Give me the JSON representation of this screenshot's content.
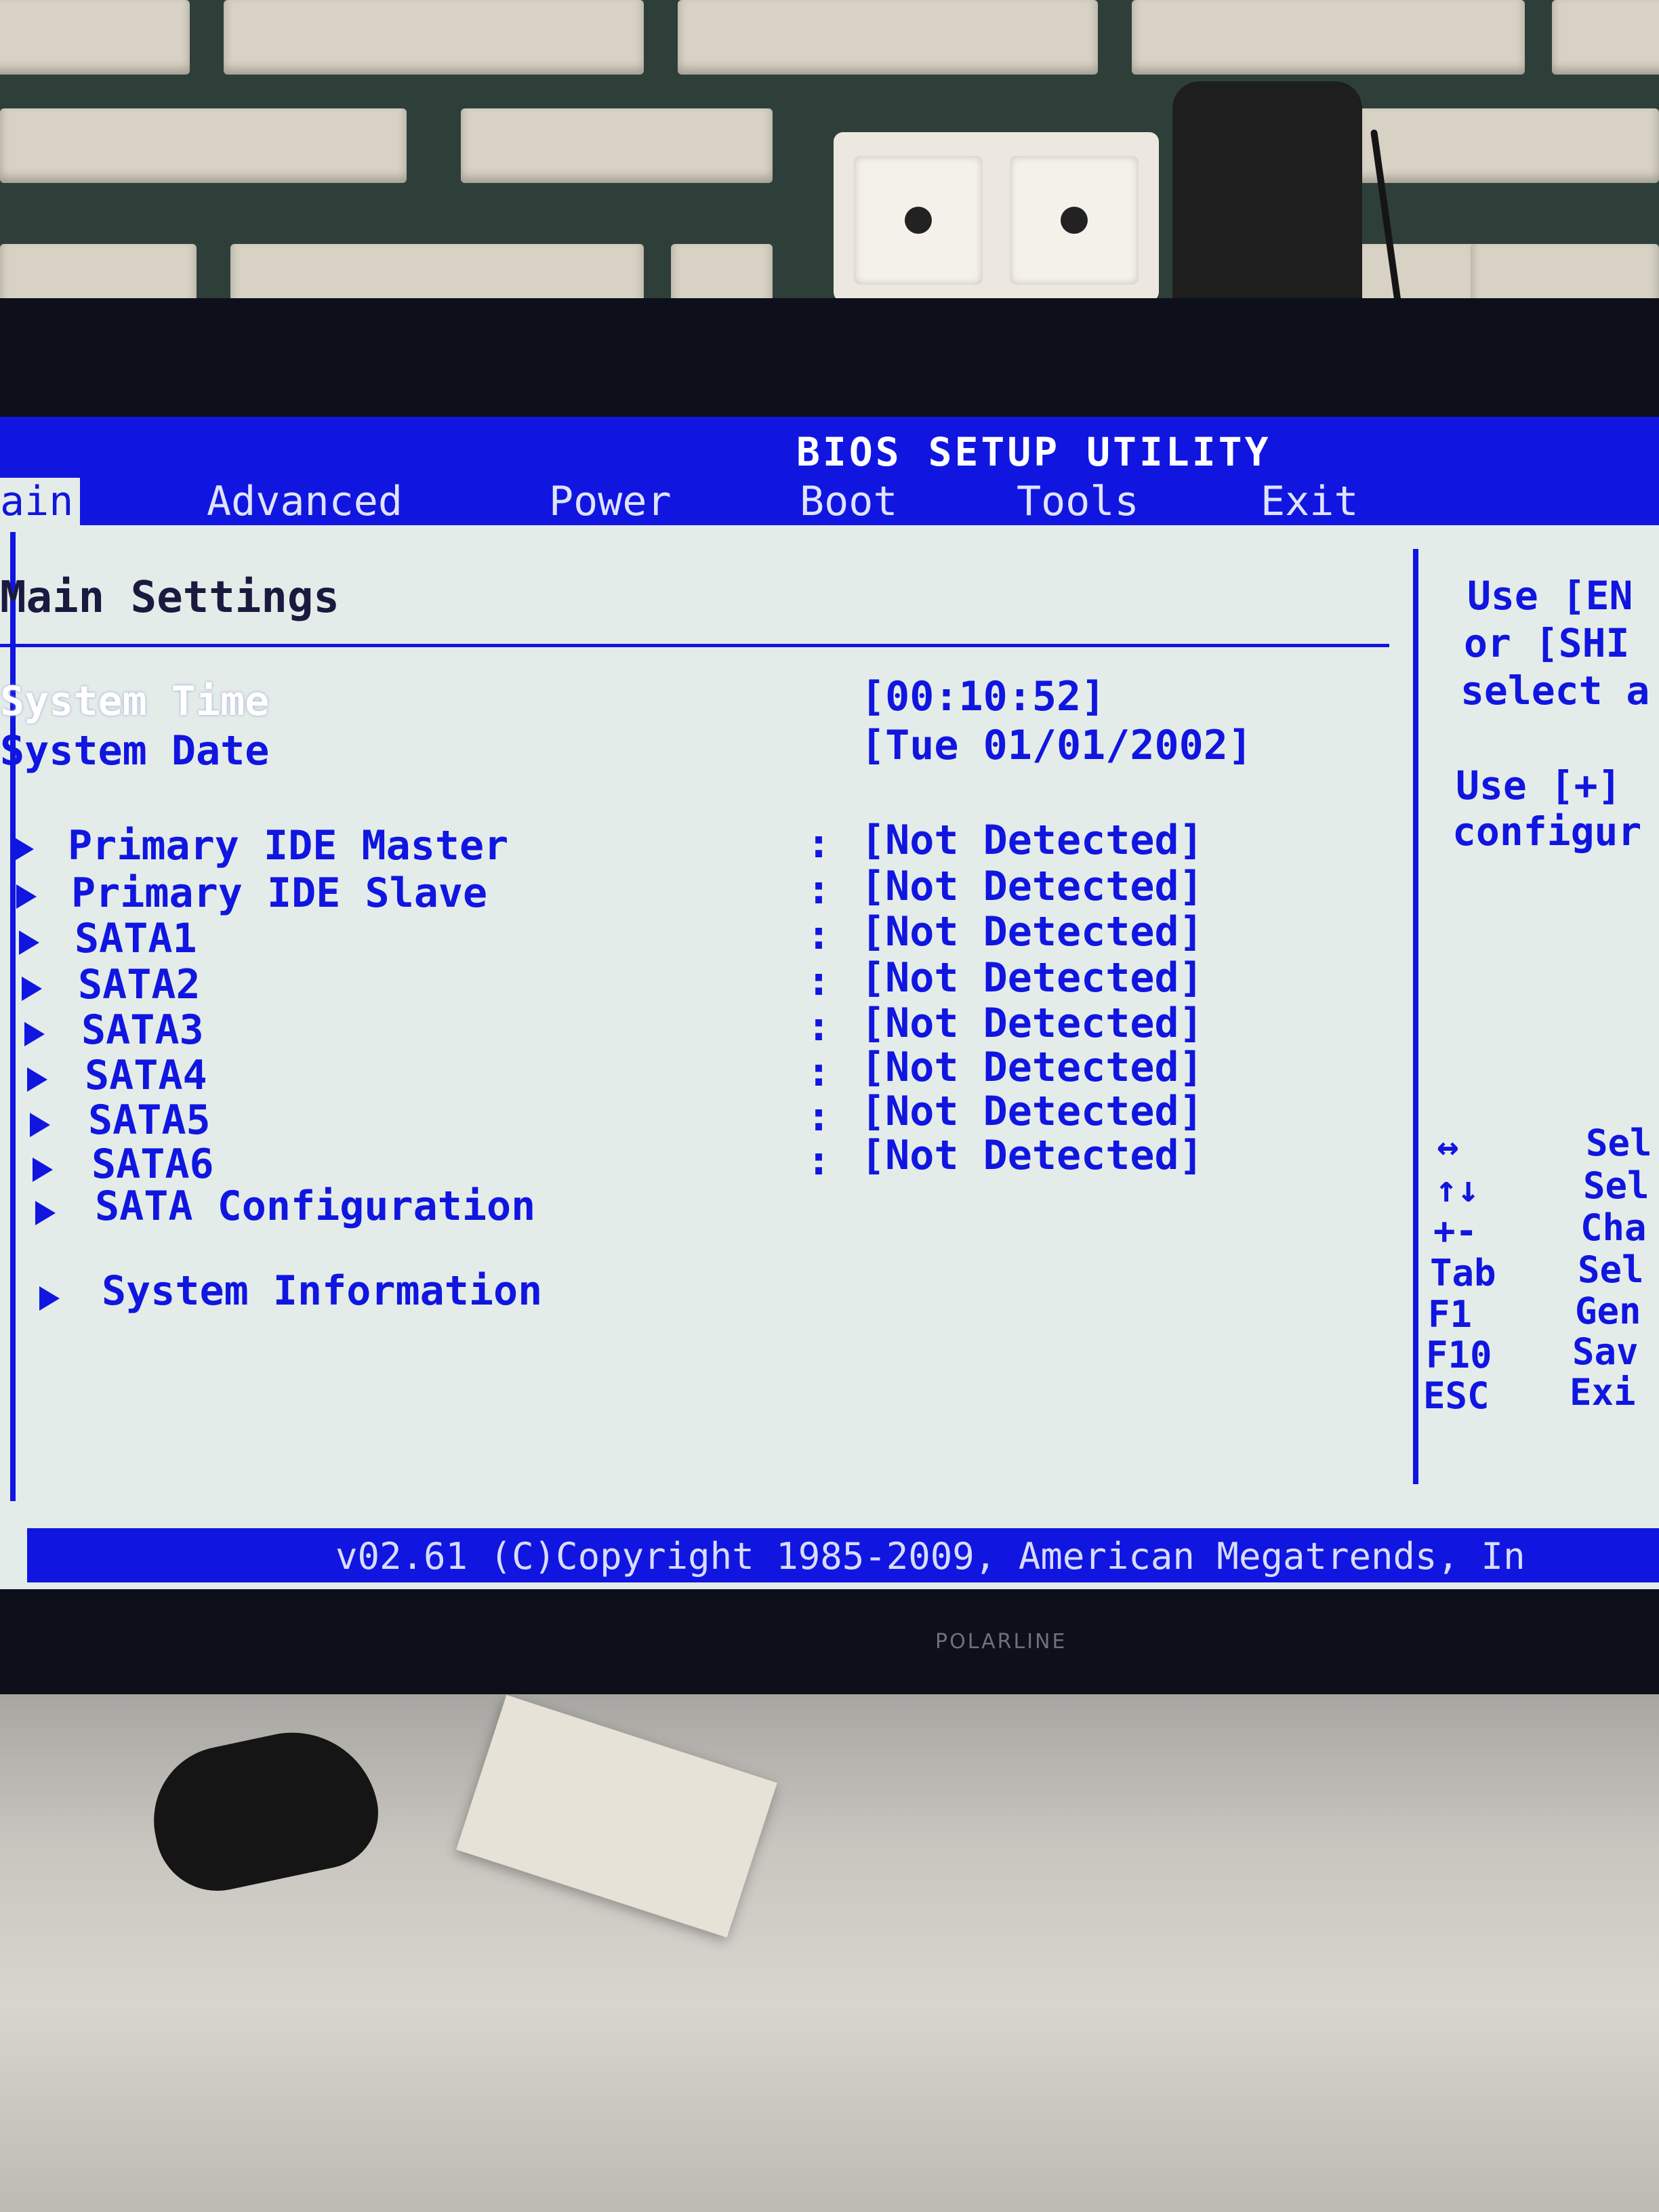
{
  "bios": {
    "title": "BIOS SETUP UTILITY",
    "menu": [
      "ain",
      "Advanced",
      "Power",
      "Boot",
      "Tools",
      "Exit"
    ],
    "section_title": "Main Settings",
    "system_time_label": "System Time",
    "system_time_value": "[00:10:52]",
    "system_date_label": "System Date",
    "system_date_value": "[Tue 01/01/2002]",
    "devices": [
      {
        "label": "Primary IDE Master",
        "value": "[Not Detected]"
      },
      {
        "label": "Primary IDE Slave",
        "value": "[Not Detected]"
      },
      {
        "label": "SATA1",
        "value": "[Not Detected]"
      },
      {
        "label": "SATA2",
        "value": "[Not Detected]"
      },
      {
        "label": "SATA3",
        "value": "[Not Detected]"
      },
      {
        "label": "SATA4",
        "value": "[Not Detected]"
      },
      {
        "label": "SATA5",
        "value": "[Not Detected]"
      },
      {
        "label": "SATA6",
        "value": "[Not Detected]"
      }
    ],
    "sata_configuration": "SATA Configuration",
    "system_information": "System Information",
    "help_lines": [
      "Use [EN",
      "or [SHI",
      "select a",
      "Use [+]",
      "configur"
    ],
    "keys": [
      {
        "key": "↔",
        "desc": "Sel"
      },
      {
        "key": "↑↓",
        "desc": "Sel"
      },
      {
        "key": "+-",
        "desc": "Cha"
      },
      {
        "key": "Tab",
        "desc": "Sel"
      },
      {
        "key": "F1",
        "desc": "Gen"
      },
      {
        "key": "F10",
        "desc": "Sav"
      },
      {
        "key": "ESC",
        "desc": "Exi"
      }
    ],
    "footer": "v02.61 (C)Copyright 1985-2009, American Megatrends, In"
  },
  "monitor_brand": "POLARLINE",
  "colors": {
    "bios_blue": "#1016e0",
    "bios_background": "#e4ece9"
  }
}
